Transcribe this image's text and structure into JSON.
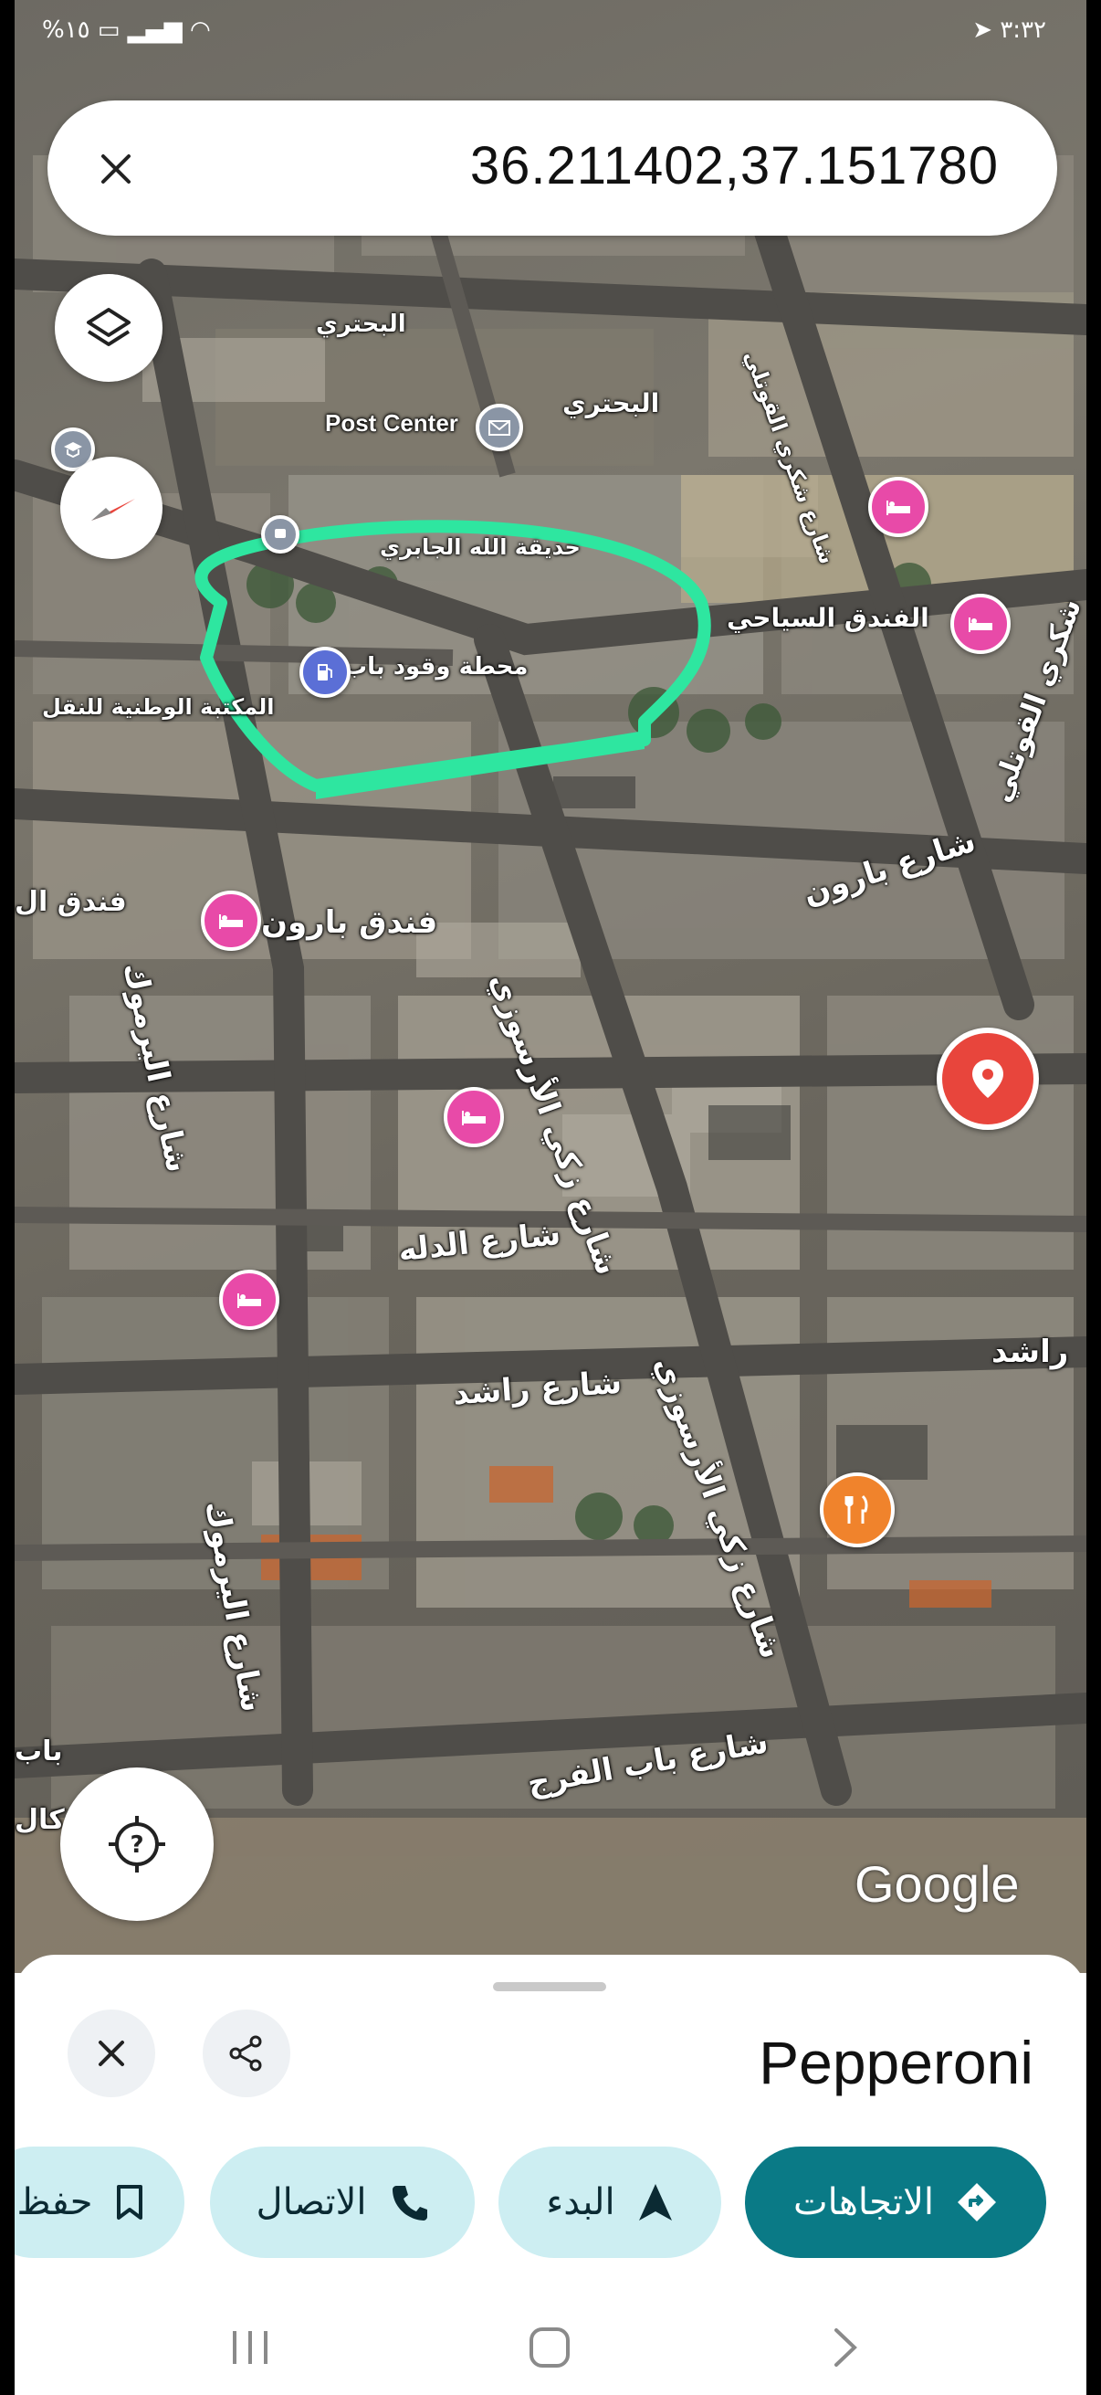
{
  "status_bar": {
    "time": "٣:٣٢",
    "battery": "%١٥"
  },
  "search": {
    "query": "36.211402,37.151780"
  },
  "map": {
    "labels": {
      "post_center": "Post Center",
      "bahtari_1": "البحتري",
      "bahtari_2": "البحتري",
      "shukri": "شارع شكري القوتلي",
      "hotel_1": "الفندق السياحي",
      "baron_street": "شارع بارون",
      "baron_hotel": "فندق بارون",
      "baron_hotel_left": "فندق ال",
      "quwatli": "شكري القوتلي",
      "armusi_1": "شارع زكي الأرسوزي",
      "armusi_2": "شارع زكي الأرسوزي",
      "yarmouk_1": "شارع اليرموك",
      "yarmouk_2": "شارع اليرموك",
      "dala": "شارع الدله",
      "rashed": "شارع راشد",
      "rashed_right": "راشد",
      "bab_faraj": "شارع باب الفرج",
      "left_bab": "باب",
      "left_kal": "كال",
      "fuel_station": "محطة وقود باب",
      "garden": "حديقة الله الجابري",
      "library": "المكتبة الوطنية للنقل"
    },
    "google_logo": "Google",
    "annotation_color": "#2ee6a0"
  },
  "place": {
    "name": "Pepperoni"
  },
  "actions": {
    "directions": "الاتجاهات",
    "start": "البدء",
    "call": "الاتصال",
    "save": "حفظ"
  },
  "colors": {
    "accent": "#0a7a86",
    "chip": "#cdeef2",
    "hotel": "#e84aa8",
    "restaurant": "#f0832c",
    "pin": "#e8453c"
  }
}
